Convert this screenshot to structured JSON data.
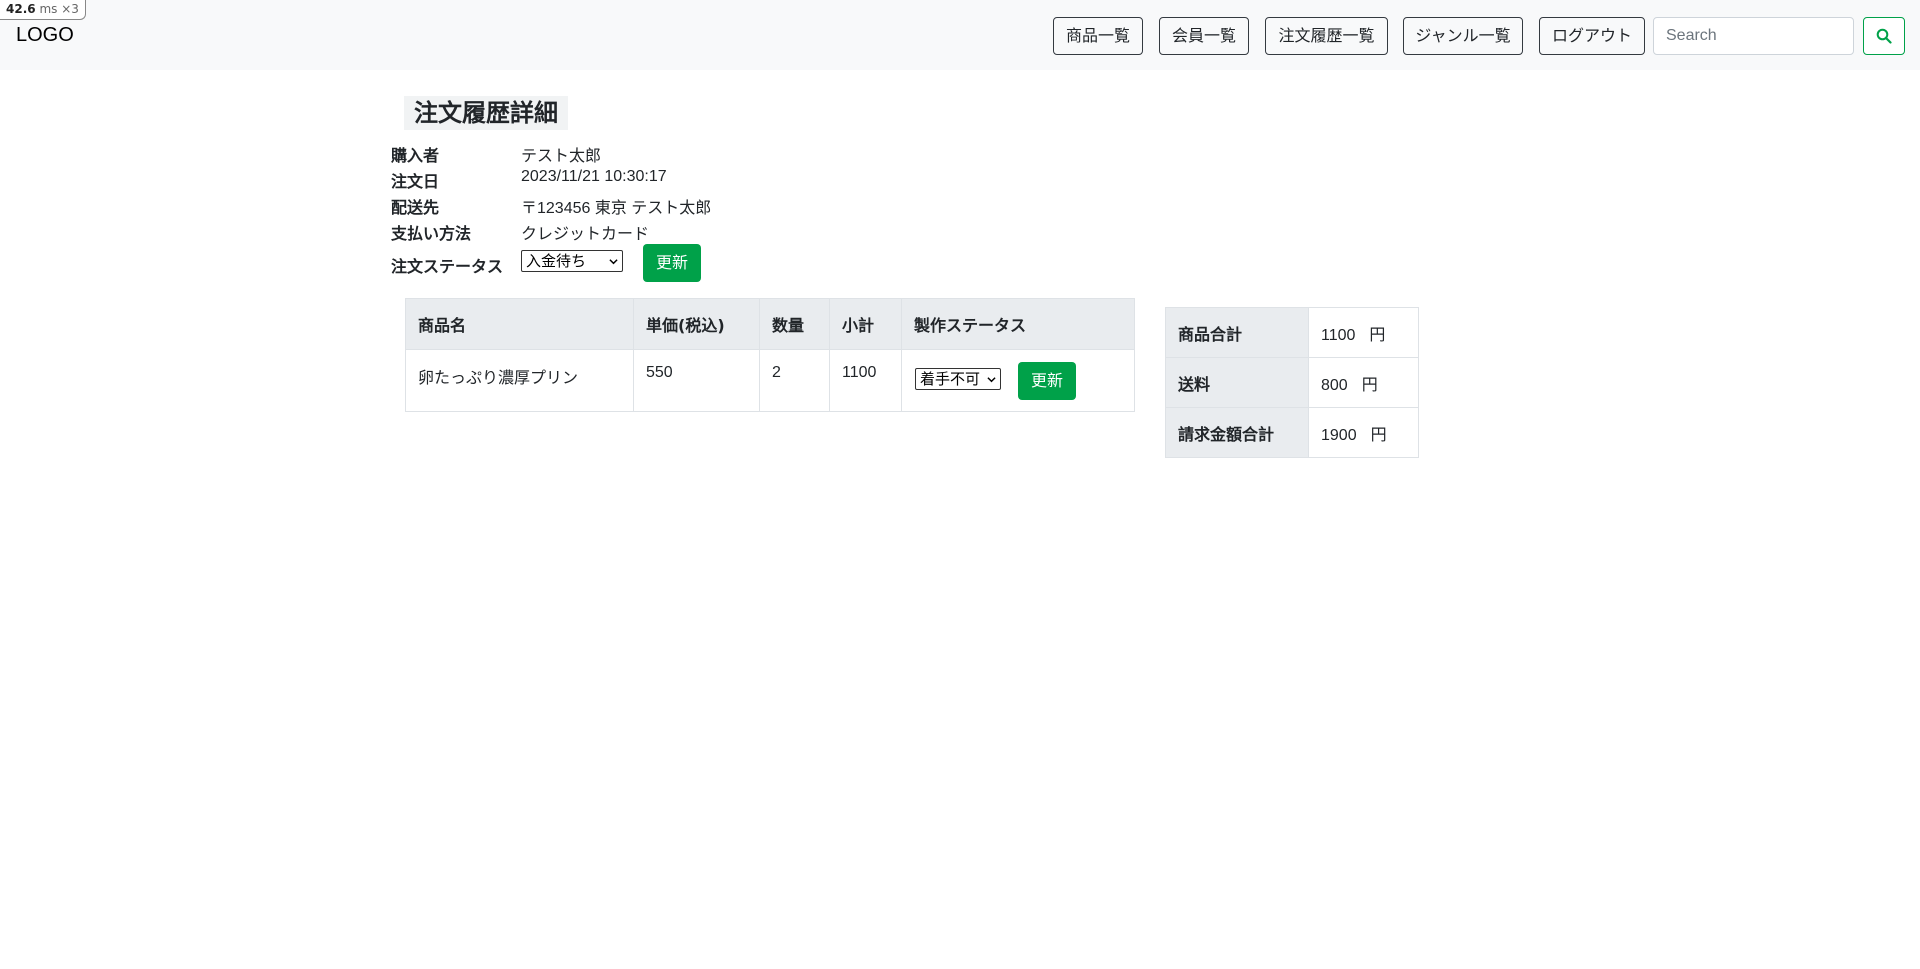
{
  "perf": {
    "value": "42.6",
    "unit": "ms",
    "multiplier": "×3"
  },
  "navbar": {
    "logo": "LOGO",
    "buttons": [
      "商品一覧",
      "会員一覧",
      "注文履歴一覧",
      "ジャンル一覧",
      "ログアウト"
    ],
    "search_placeholder": "Search",
    "search_icon": "search-icon"
  },
  "page": {
    "title": "注文履歴詳細"
  },
  "order": {
    "buyer_label": "購入者",
    "buyer": "テスト太郎",
    "date_label": "注文日",
    "date": "2023/11/21 10:30:17",
    "address_label": "配送先",
    "address": "〒123456 東京 テスト太郎",
    "payment_label": "支払い方法",
    "payment": "クレジットカード",
    "status_label": "注文ステータス",
    "status_value": "入金待ち",
    "update_label": "更新"
  },
  "items": {
    "headers": [
      "商品名",
      "単価(税込)",
      "数量",
      "小計",
      "製作ステータス"
    ],
    "rows": [
      {
        "name": "卵たっぷり濃厚プリン",
        "price": "550",
        "quantity": "2",
        "subtotal": "1100",
        "making_status": "着手不可",
        "update_label": "更新"
      }
    ]
  },
  "summary": {
    "rows": [
      {
        "label": "商品合計",
        "value": "1100",
        "unit": "円"
      },
      {
        "label": "送料",
        "value": "800",
        "unit": "円"
      },
      {
        "label": "請求金額合計",
        "value": "1900",
        "unit": "円"
      }
    ]
  },
  "colors": {
    "accent": "#00a149",
    "header_bg": "#e9ecef",
    "navbar_bg": "#f8f9fa"
  }
}
